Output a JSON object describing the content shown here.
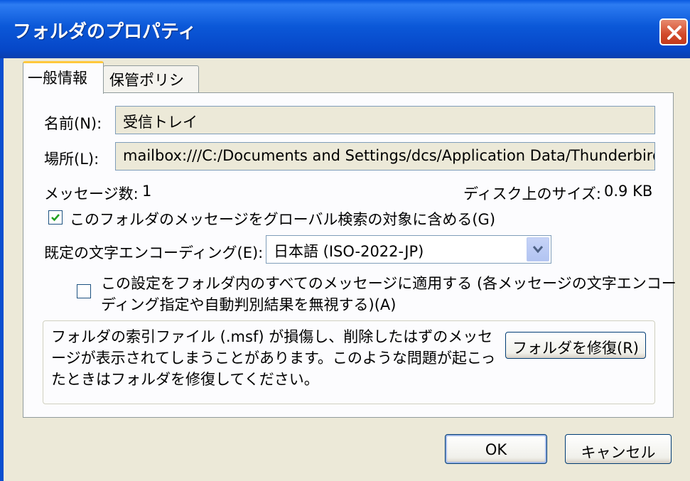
{
  "window": {
    "title": "フォルダのプロパティ",
    "close_icon": "close-icon"
  },
  "tabs": [
    {
      "label": "一般情報",
      "active": true
    },
    {
      "label": "保管ポリシー",
      "active": false
    }
  ],
  "general": {
    "name_label": "名前(N):",
    "name_value": "受信トレイ",
    "location_label": "場所(L):",
    "location_value": "mailbox:///C:/Documents and Settings/dcs/Application Data/Thunderbird",
    "message_count_label": "メッセージ数:",
    "message_count_value": "1",
    "disk_size_label": "ディスク上のサイズ:",
    "disk_size_value": "0.9 KB",
    "global_search_checkbox": {
      "label": "このフォルダのメッセージをグローバル検索の対象に含める(G)",
      "checked": true
    },
    "encoding_label": "既定の文字エンコーディング(E):",
    "encoding_value": "日本語 (ISO-2022-JP)",
    "apply_all_checkbox": {
      "label_line1": "この設定をフォルダ内のすべてのメッセージに適用する (各メッセージの文字エンコー",
      "label_line2": "ディング指定や自動判別結果を無視する)(A)",
      "checked": false
    },
    "repair_notice": "フォルダの索引ファイル (.msf) が損傷し、削除したはずのメッセージが表示されてしまうことがあります。このような問題が起こったときはフォルダを修復してください。",
    "repair_button": "フォルダを修復(R)"
  },
  "footer": {
    "ok": "OK",
    "cancel": "キャンセル"
  },
  "colors": {
    "titlebar": "#0b58d8",
    "dialog_bg": "#ece9d8",
    "tab_highlight": "#ffc83c"
  }
}
